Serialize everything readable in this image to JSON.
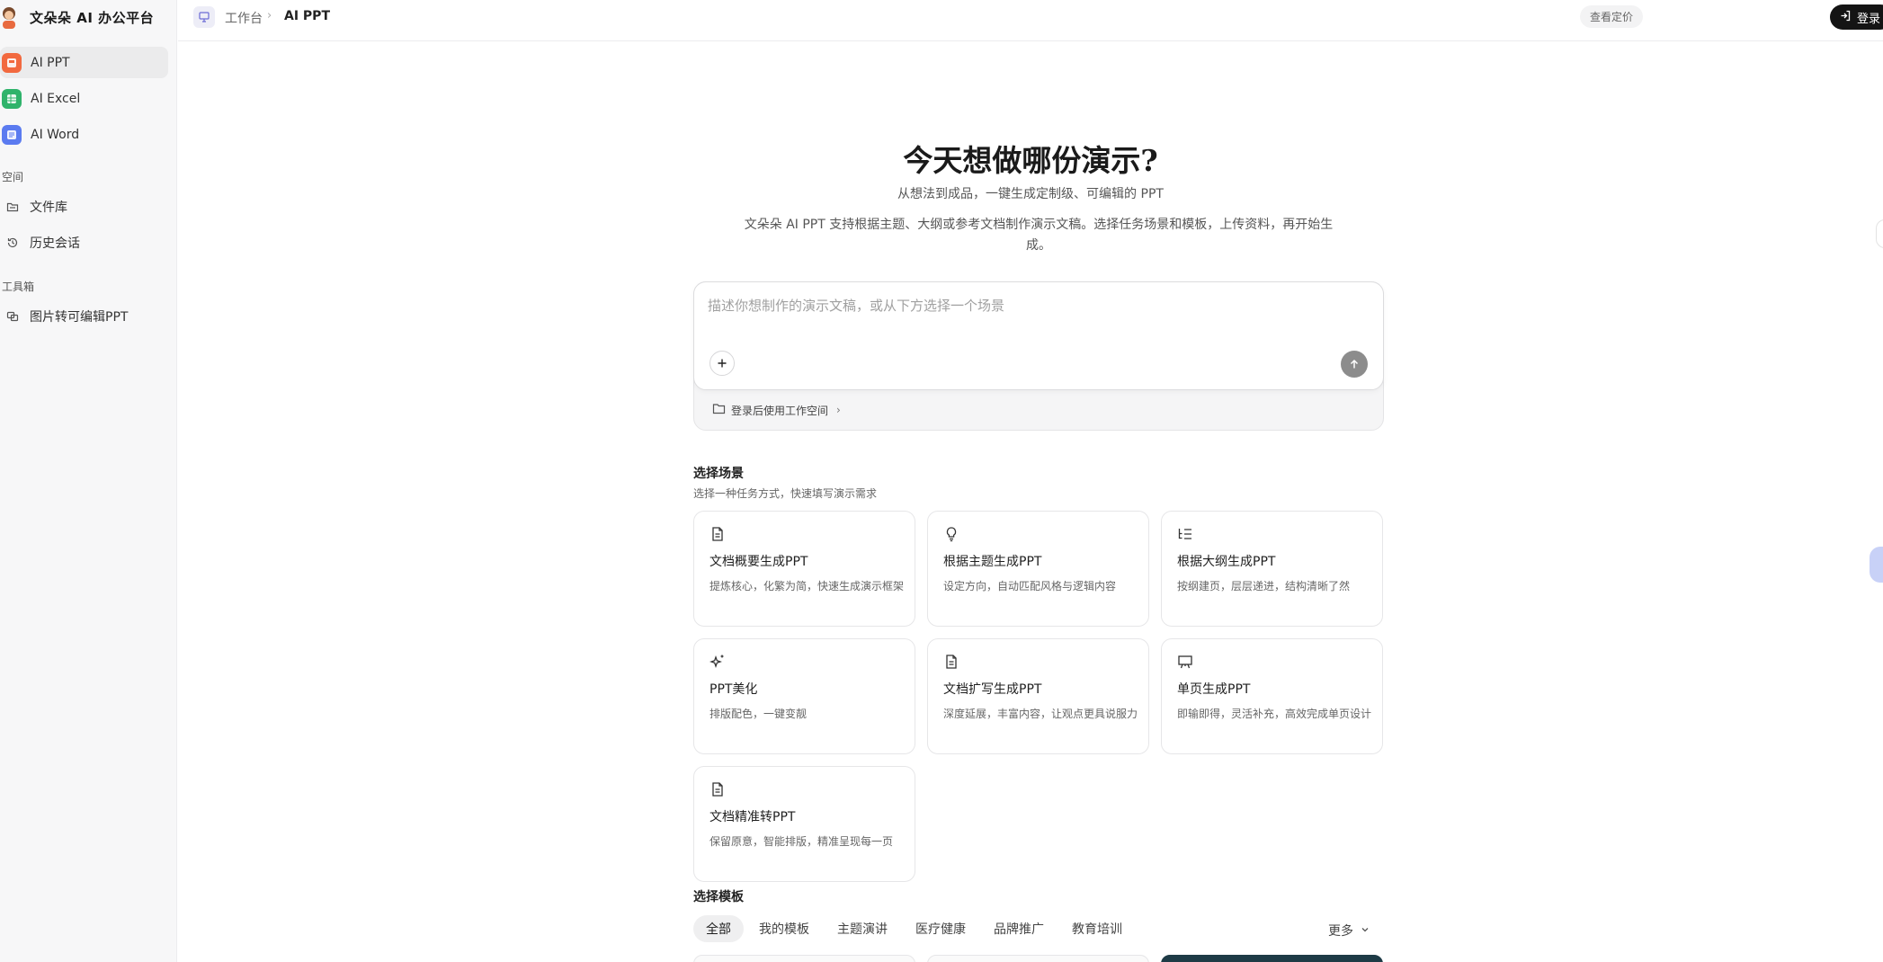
{
  "brand": {
    "name": "文朵朵 AI 办公平台"
  },
  "sidebar": {
    "apps": [
      {
        "label": "AI PPT",
        "color": "#f2693f"
      },
      {
        "label": "AI Excel",
        "color": "#2fb36b"
      },
      {
        "label": "AI Word",
        "color": "#5b7bf0"
      }
    ],
    "space_label": "空间",
    "space_items": [
      {
        "label": "文件库",
        "icon": "folder-icon"
      },
      {
        "label": "历史会话",
        "icon": "history-icon"
      }
    ],
    "tools_label": "工具箱",
    "tool_items": [
      {
        "label": "图片转可编辑PPT",
        "icon": "image-convert-icon"
      }
    ]
  },
  "topbar": {
    "breadcrumb": [
      "工作台",
      "AI PPT"
    ],
    "pricing_label": "查看定价",
    "login_label": "登录"
  },
  "hero": {
    "title": "今天想做哪份演示?",
    "subtitle": "从想法到成品，一键生成定制级、可编辑的 PPT",
    "description": "文朵朵 AI PPT 支持根据主题、大纲或参考文档制作演示文稿。选择任务场景和模板，上传资料，再开始生成。"
  },
  "composer": {
    "placeholder": "描述你想制作的演示文稿，或从下方选择一个场景",
    "value": "",
    "workspace_link": "登录后使用工作空间"
  },
  "scenes": {
    "title": "选择场景",
    "hint": "选择一种任务方式，快速填写演示需求",
    "cards": [
      {
        "icon": "document-icon",
        "title": "文档概要生成PPT",
        "desc": "提炼核心，化繁为简，快速生成演示框架"
      },
      {
        "icon": "lightbulb-icon",
        "title": "根据主题生成PPT",
        "desc": "设定方向，自动匹配风格与逻辑内容"
      },
      {
        "icon": "outline-list-icon",
        "title": "根据大纲生成PPT",
        "desc": "按纲建页，层层递进，结构清晰了然"
      },
      {
        "icon": "sparkles-icon",
        "title": "PPT美化",
        "desc": "排版配色，一键变靓"
      },
      {
        "icon": "document-icon",
        "title": "文档扩写生成PPT",
        "desc": "深度延展，丰富内容，让观点更具说服力"
      },
      {
        "icon": "presentation-icon",
        "title": "单页生成PPT",
        "desc": "即输即得，灵活补充，高效完成单页设计"
      },
      {
        "icon": "document-icon",
        "title": "文档精准转PPT",
        "desc": "保留原意，智能排版，精准呈现每一页"
      }
    ]
  },
  "templates": {
    "title": "选择模板",
    "tabs": [
      "全部",
      "我的模板",
      "主题演讲",
      "医疗健康",
      "品牌推广",
      "教育培训"
    ],
    "active_tab": "全部",
    "more_label": "更多"
  }
}
